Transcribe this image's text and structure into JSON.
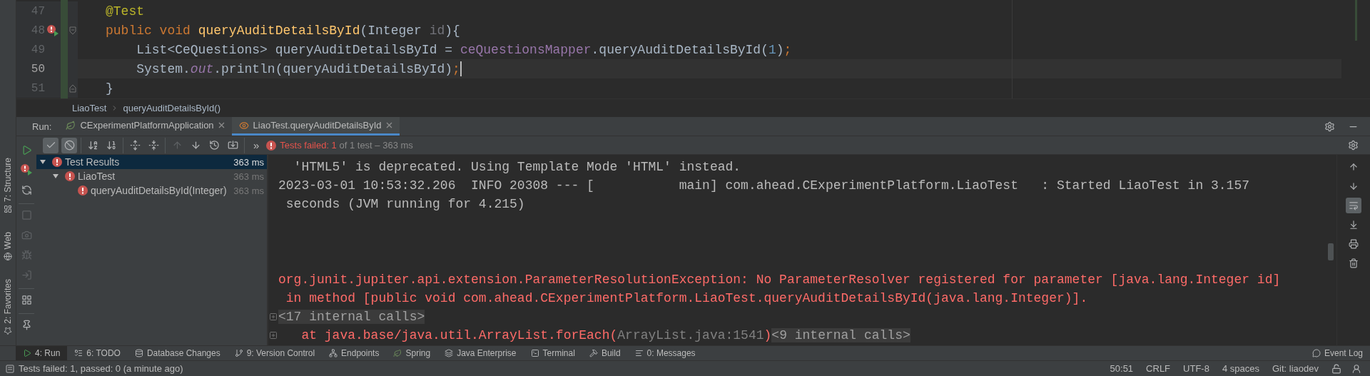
{
  "left_strip": [
    {
      "label": "7: Structure",
      "kind": "structure"
    },
    {
      "label": "Web",
      "kind": "web"
    },
    {
      "label": "2: Favorites",
      "kind": "favorites"
    }
  ],
  "editor": {
    "lines": [
      {
        "number": "47",
        "current": false,
        "run_marker": false,
        "fold_start": false,
        "fold_end": false,
        "tokens": [
          {
            "kind": "annotation",
            "text": "@Test"
          }
        ]
      },
      {
        "number": "48",
        "current": false,
        "run_marker": true,
        "fold_start": true,
        "fold_end": false,
        "tokens": [
          {
            "kind": "keyword",
            "text": "public void "
          },
          {
            "kind": "declaration",
            "text": "queryAuditDetailsById"
          },
          {
            "kind": "plain",
            "text": "(Integer "
          },
          {
            "kind": "unused",
            "text": "id"
          },
          {
            "kind": "plain",
            "text": "){"
          }
        ]
      },
      {
        "number": "49",
        "current": false,
        "run_marker": false,
        "fold_start": false,
        "fold_end": false,
        "tokens": [
          {
            "kind": "plain",
            "text": "    List<CeQuestions> queryAuditDetailsById = "
          },
          {
            "kind": "field",
            "text": "ceQuestionsMapper"
          },
          {
            "kind": "plain",
            "text": ".queryAuditDetailsById("
          },
          {
            "kind": "number",
            "text": "1"
          },
          {
            "kind": "plain",
            "text": ")"
          },
          {
            "kind": "keyword",
            "text": ";"
          }
        ]
      },
      {
        "number": "50",
        "current": true,
        "run_marker": false,
        "fold_start": false,
        "fold_end": false,
        "tokens": [
          {
            "kind": "plain",
            "text": "    System."
          },
          {
            "kind": "static",
            "text": "out"
          },
          {
            "kind": "plain",
            "text": ".println(queryAuditDetailsById)"
          },
          {
            "kind": "keyword",
            "text": ";"
          }
        ]
      },
      {
        "number": "51",
        "current": false,
        "run_marker": false,
        "fold_start": false,
        "fold_end": true,
        "tokens": [
          {
            "kind": "plain",
            "text": "}"
          }
        ]
      }
    ],
    "breadcrumbs": [
      "LiaoTest",
      "queryAuditDetailsById()"
    ]
  },
  "run": {
    "label": "Run:",
    "tabs": [
      {
        "label": "CExperimentPlatformApplication",
        "kind": "spring",
        "selected": false
      },
      {
        "label": "LiaoTest.queryAuditDetailsById",
        "kind": "test",
        "selected": true
      }
    ],
    "window_actions": [
      {
        "kind": "settings"
      },
      {
        "kind": "minimize"
      }
    ],
    "actions": [
      {
        "buttons": [
          {
            "kind": "run",
            "disabled": false
          },
          {
            "kind": "rerun_failed",
            "disabled": false
          },
          {
            "kind": "toggle_rerun",
            "disabled": false
          }
        ]
      },
      {
        "buttons": [
          {
            "kind": "stop",
            "disabled": true
          },
          {
            "kind": "camera",
            "disabled": true
          },
          {
            "kind": "debug",
            "disabled": true
          },
          {
            "kind": "exit",
            "disabled": true
          }
        ]
      },
      {
        "buttons": [
          {
            "kind": "layout",
            "disabled": false
          }
        ]
      },
      {
        "buttons": [
          {
            "kind": "pin",
            "disabled": false
          }
        ]
      }
    ],
    "toolbar": [
      {
        "buttons": [
          {
            "kind": "passed",
            "toggled": true,
            "disabled": false
          },
          {
            "kind": "ignored",
            "toggled": true,
            "disabled": false
          }
        ]
      },
      {
        "buttons": [
          {
            "kind": "sort_alpha",
            "toggled": false,
            "disabled": false
          },
          {
            "kind": "sort_duration",
            "toggled": false,
            "disabled": false
          }
        ]
      },
      {
        "buttons": [
          {
            "kind": "expand_all",
            "toggled": false,
            "disabled": false
          },
          {
            "kind": "collapse_all",
            "toggled": false,
            "disabled": false
          }
        ]
      },
      {
        "buttons": [
          {
            "kind": "previous",
            "toggled": false,
            "disabled": true
          },
          {
            "kind": "next",
            "toggled": false,
            "disabled": false
          },
          {
            "kind": "history",
            "toggled": false,
            "disabled": false
          },
          {
            "kind": "import",
            "toggled": false,
            "disabled": false
          }
        ]
      }
    ],
    "more": "»",
    "summary": {
      "failed": "Tests failed: 1",
      "rest": "of 1 test – 363 ms"
    },
    "toolbar_right": [
      {
        "kind": "settings"
      }
    ],
    "tree": [
      {
        "label": "Test Results",
        "time": "363 ms",
        "selected": true,
        "expanded": true,
        "children": [
          {
            "label": "LiaoTest",
            "time": "363 ms",
            "selected": false,
            "expanded": true,
            "children": [
              {
                "label": "queryAuditDetailsById(Integer)",
                "time": "363 ms",
                "selected": false
              }
            ]
          }
        ]
      }
    ],
    "console": [
      {
        "foldable": false,
        "segments": [
          {
            "kind": "log",
            "text": "  'HTML5' is deprecated. Using Template Mode 'HTML' instead."
          }
        ]
      },
      {
        "foldable": false,
        "segments": [
          {
            "kind": "log",
            "text": "2023-03-01 10:53:32.206  INFO 20308 --- [           main] com.ahead.CExperimentPlatform.LiaoTest   : Started LiaoTest in 3.157"
          }
        ]
      },
      {
        "foldable": false,
        "segments": [
          {
            "kind": "log",
            "text": " seconds (JVM running for 4.215)"
          }
        ]
      },
      {
        "foldable": false,
        "segments": [
          {
            "kind": "error",
            "text": "org.junit.jupiter.api.extension.ParameterResolutionException: No ParameterResolver registered for parameter [java.lang.Integer id]"
          }
        ]
      },
      {
        "foldable": false,
        "segments": [
          {
            "kind": "error",
            "text": " in method [public void com.ahead.CExperimentPlatform.LiaoTest.queryAuditDetailsById(java.lang.Integer)]."
          }
        ]
      },
      {
        "foldable": true,
        "segments": [
          {
            "kind": "folded",
            "text": "<17 internal calls>"
          }
        ]
      },
      {
        "foldable": true,
        "segments": [
          {
            "kind": "error",
            "text": "   at java.base/java.util.ArrayList.forEach("
          },
          {
            "kind": "link",
            "text": "ArrayList.java:1541"
          },
          {
            "kind": "error",
            "text": ")"
          },
          {
            "kind": "folded",
            "text": "<9 internal calls>"
          }
        ]
      }
    ],
    "console_actions": [
      {
        "kind": "up",
        "toggled": false
      },
      {
        "kind": "down",
        "toggled": false
      },
      {
        "kind": "soft_wrap",
        "toggled": true
      },
      {
        "kind": "scroll_end",
        "toggled": false
      },
      {
        "kind": "print",
        "toggled": false
      },
      {
        "kind": "clear",
        "toggled": false
      }
    ]
  },
  "tool_windows": [
    {
      "label": "4: Run",
      "kind": "run",
      "selected": true
    },
    {
      "label": "6: TODO",
      "kind": "todo",
      "selected": false
    },
    {
      "label": "Database Changes",
      "kind": "database",
      "selected": false
    },
    {
      "label": "9: Version Control",
      "kind": "vcs",
      "selected": false
    },
    {
      "label": "Endpoints",
      "kind": "endpoints",
      "selected": false
    },
    {
      "label": "Spring",
      "kind": "spring",
      "selected": false
    },
    {
      "label": "Java Enterprise",
      "kind": "enterprise",
      "selected": false
    },
    {
      "label": "Terminal",
      "kind": "terminal",
      "selected": false
    },
    {
      "label": "Build",
      "kind": "build",
      "selected": false
    },
    {
      "label": "0: Messages",
      "kind": "messages",
      "selected": false
    }
  ],
  "event_log": "Event Log",
  "status_bar": {
    "message": "Tests failed: 1, passed: 0 (a minute ago)",
    "items": [
      "50:51",
      "CRLF",
      "UTF-8",
      "4 spaces",
      "Git: liaodev"
    ]
  }
}
